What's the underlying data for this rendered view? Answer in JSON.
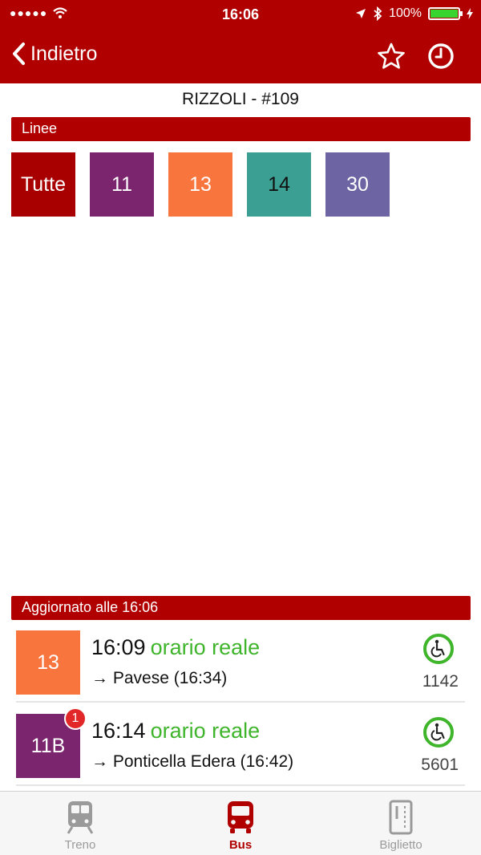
{
  "status_bar": {
    "signal_dots": "●●●●●",
    "time": "16:06",
    "battery_text": "100%",
    "battery_level": 1.0,
    "battery_color": "#38d430"
  },
  "nav": {
    "back_label": "Indietro",
    "back_icon": "chevron-left-icon",
    "favorite_icon": "star-icon",
    "history_icon": "clock-icon",
    "bar_color": "#b00000"
  },
  "stop": {
    "title": "RIZZOLI - #109"
  },
  "lines_section": {
    "header": "Linee",
    "items": [
      {
        "label": "Tutte",
        "color": "#a80000",
        "text_color": "#ffffff"
      },
      {
        "label": "11",
        "color": "#7a256e",
        "text_color": "#ffffff"
      },
      {
        "label": "13",
        "color": "#f9753e",
        "text_color": "#ffffff"
      },
      {
        "label": "14",
        "color": "#3b9f94",
        "text_color": "#111111"
      },
      {
        "label": "30",
        "color": "#6d64a3",
        "text_color": "#ffffff"
      }
    ]
  },
  "departures": {
    "header": "Aggiornato alle 16:06",
    "rows": [
      {
        "line": "13",
        "color": "#f9753e",
        "time": "16:09",
        "live_label": "orario reale",
        "destination": "→ Pavese (16:34)",
        "vehicle": "1142",
        "alert": ""
      },
      {
        "line": "11B",
        "color": "#7a256e",
        "time": "16:14",
        "live_label": "orario reale",
        "destination": "→ Ponticella Edera (16:42)",
        "vehicle": "5601",
        "alert": "1"
      }
    ]
  },
  "tabs": [
    {
      "label": "Treno",
      "icon": "train-icon",
      "active": false
    },
    {
      "label": "Bus",
      "icon": "bus-icon",
      "active": true
    },
    {
      "label": "Biglietto",
      "icon": "ticket-icon",
      "active": false
    }
  ]
}
